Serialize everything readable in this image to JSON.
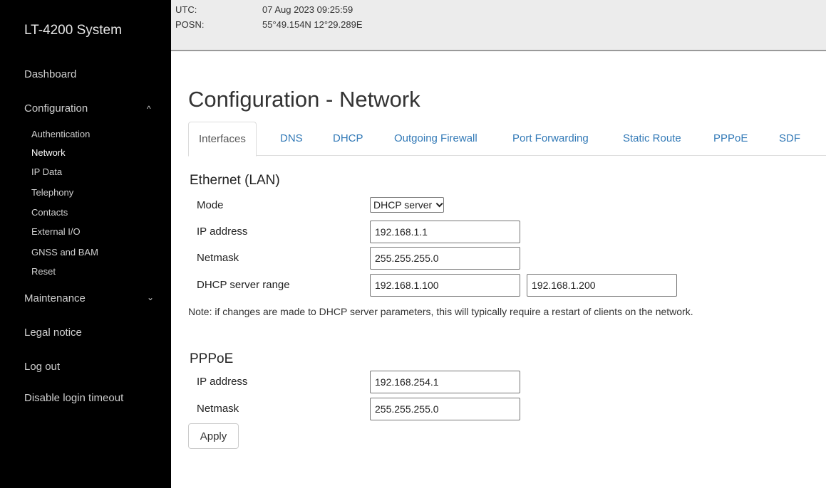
{
  "app": {
    "title": "LT-4200 System"
  },
  "header": {
    "utc_label": "UTC:",
    "utc_value": "07 Aug 2023 09:25:59",
    "posn_label": "POSN:",
    "posn_value": "55°49.154N 12°29.289E"
  },
  "sidebar": {
    "dashboard": "Dashboard",
    "configuration": "Configuration",
    "configuration_caret": "^",
    "config_items": [
      "Authentication",
      "Network",
      "IP Data",
      "Telephony",
      "Contacts",
      "External I/O",
      "GNSS and BAM",
      "Reset"
    ],
    "maintenance": "Maintenance",
    "maintenance_caret": "⌄",
    "legal": "Legal notice",
    "logout": "Log out",
    "disable_timeout": "Disable login timeout"
  },
  "page": {
    "title": "Configuration - Network"
  },
  "tabs": [
    "Interfaces",
    "DNS",
    "DHCP",
    "Outgoing Firewall",
    "Port Forwarding",
    "Static Route",
    "PPPoE",
    "SDF"
  ],
  "ethernet": {
    "title": "Ethernet (LAN)",
    "mode_label": "Mode",
    "mode_value": "DHCP server",
    "ip_label": "IP address",
    "ip_value": "192.168.1.1",
    "netmask_label": "Netmask",
    "netmask_value": "255.255.255.0",
    "range_label": "DHCP server range",
    "range_start": "192.168.1.100",
    "range_end": "192.168.1.200"
  },
  "note": "Note: if changes are made to DHCP server parameters, this will typically require a restart of clients on the network.",
  "pppoe": {
    "title": "PPPoE",
    "ip_label": "IP address",
    "ip_value": "192.168.254.1",
    "netmask_label": "Netmask",
    "netmask_value": "255.255.255.0"
  },
  "apply_label": "Apply",
  "colors": {
    "sidebar_bg": "#000000",
    "link": "#337ab7",
    "header_bg": "#ececec"
  }
}
